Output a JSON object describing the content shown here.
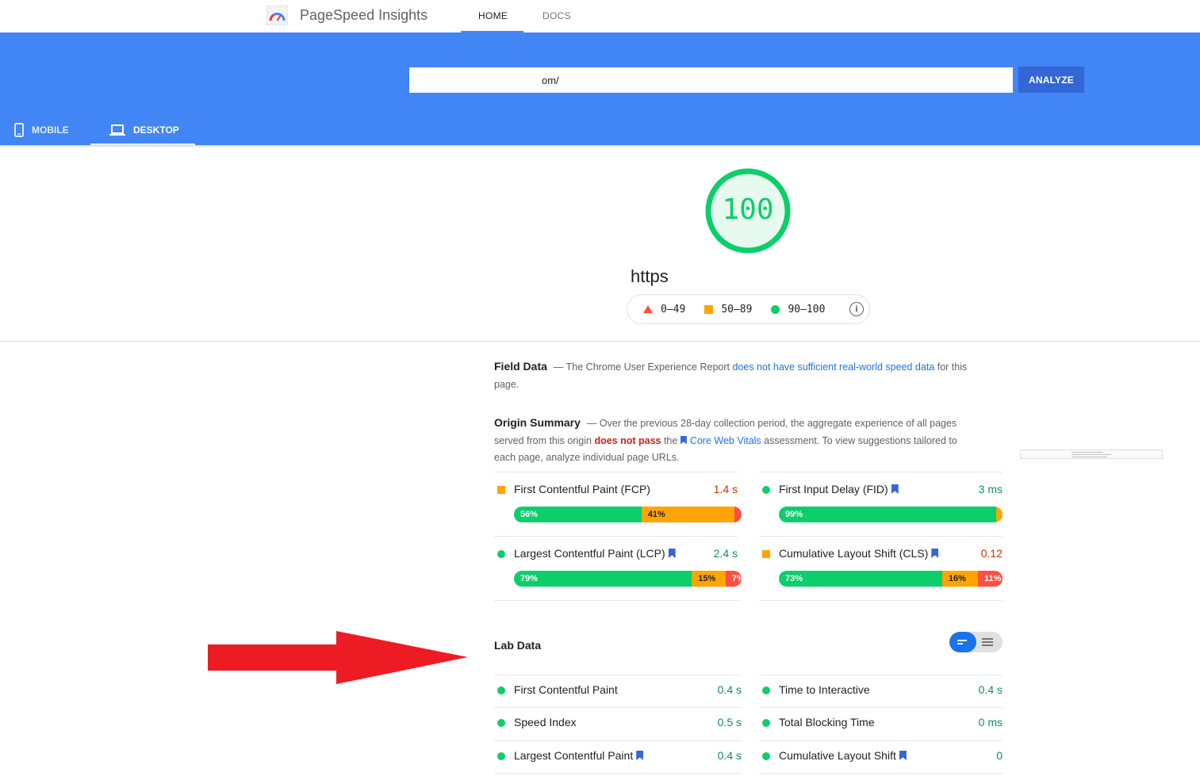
{
  "nav": {
    "brand": "PageSpeed Insights",
    "tabs": [
      {
        "label": "HOME"
      },
      {
        "label": "DOCS"
      }
    ]
  },
  "search": {
    "value": "om/",
    "analyze_label": "ANALYZE"
  },
  "device_tabs": [
    {
      "label": "MOBILE"
    },
    {
      "label": "DESKTOP"
    }
  ],
  "score": {
    "value": "100",
    "url": "https"
  },
  "legend": {
    "fail": "0–49",
    "average": "50–89",
    "pass": "90–100"
  },
  "field_data": {
    "heading": "Field Data",
    "text_before": "— The Chrome User Experience Report ",
    "link": "does not have sufficient real-world speed data",
    "text_after": " for this page."
  },
  "origin_summary": {
    "heading": "Origin Summary",
    "text_1": "— Over the previous 28-day collection period, the aggregate experience of all pages served from this origin ",
    "fail_text": "does not pass",
    "text_2": " the ",
    "link": "Core Web Vitals",
    "text_3": " assessment. To view suggestions tailored to each page, analyze individual page URLs."
  },
  "field_metrics": [
    {
      "name": "First Contentful Paint (FCP)",
      "value": "1.4 s",
      "status": "average",
      "bookmark": false,
      "dist": [
        {
          "label": "56%",
          "pct": 56,
          "kind": "g"
        },
        {
          "label": "41%",
          "pct": 41,
          "kind": "o"
        },
        {
          "label": "3%",
          "pct": 3,
          "kind": "r"
        }
      ]
    },
    {
      "name": "First Input Delay (FID)",
      "value": "3 ms",
      "status": "pass",
      "bookmark": true,
      "dist": [
        {
          "label": "99%",
          "pct": 99,
          "kind": "g"
        },
        {
          "label": "1%",
          "pct": 1,
          "kind": "o"
        }
      ]
    },
    {
      "name": "Largest Contentful Paint (LCP)",
      "value": "2.4 s",
      "status": "pass",
      "bookmark": true,
      "dist": [
        {
          "label": "79%",
          "pct": 79,
          "kind": "g"
        },
        {
          "label": "15%",
          "pct": 15,
          "kind": "o"
        },
        {
          "label": "7%",
          "pct": 7,
          "kind": "r"
        }
      ]
    },
    {
      "name": "Cumulative Layout Shift (CLS)",
      "value": "0.12",
      "status": "average",
      "bookmark": true,
      "dist": [
        {
          "label": "73%",
          "pct": 73,
          "kind": "g"
        },
        {
          "label": "16%",
          "pct": 16,
          "kind": "o"
        },
        {
          "label": "11%",
          "pct": 11,
          "kind": "r"
        }
      ]
    }
  ],
  "lab_data": {
    "heading": "Lab Data",
    "metrics": [
      {
        "name": "First Contentful Paint",
        "value": "0.4 s",
        "bookmark": false
      },
      {
        "name": "Time to Interactive",
        "value": "0.4 s",
        "bookmark": false
      },
      {
        "name": "Speed Index",
        "value": "0.5 s",
        "bookmark": false
      },
      {
        "name": "Total Blocking Time",
        "value": "0 ms",
        "bookmark": false
      },
      {
        "name": "Largest Contentful Paint",
        "value": "0.4 s",
        "bookmark": true
      },
      {
        "name": "Cumulative Layout Shift",
        "value": "0",
        "bookmark": true
      }
    ]
  },
  "colors": {
    "brand_blue": "#4285f4",
    "pass": "#0cce6b",
    "average": "#ffa400",
    "fail": "#ff4e42",
    "annotation_arrow": "#ed1c24"
  }
}
